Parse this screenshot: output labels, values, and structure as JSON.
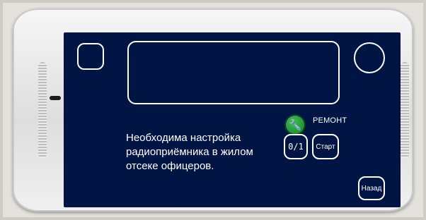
{
  "screen": {
    "repair_label": "РЕМОНТ",
    "message": "Необходима настройка радиоприёмника в жилом отсеке офицеров.",
    "counter": "0/1",
    "start_label": "Старт",
    "back_label": "Назад"
  },
  "icons": {
    "repair": "wrench-icon"
  },
  "colors": {
    "screen_bg": "#001544",
    "outline": "#ffffff",
    "repair_green": "#2fa346"
  }
}
